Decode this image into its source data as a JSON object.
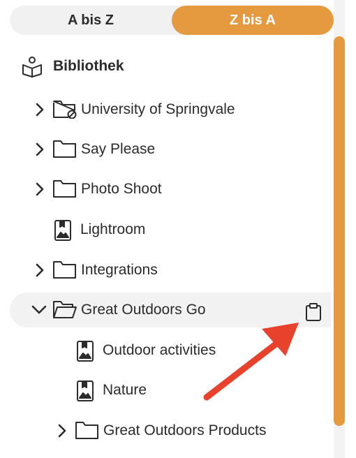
{
  "sort": {
    "az_label": "A bis Z",
    "za_label": "Z bis A",
    "active": "Z bis A"
  },
  "tree": {
    "root_label": "Bibliothek",
    "items": [
      {
        "label": "University of Springvale",
        "type": "folder-restricted",
        "expandable": true,
        "expanded": false,
        "depth": 1
      },
      {
        "label": "Say Please",
        "type": "folder",
        "expandable": true,
        "expanded": false,
        "depth": 1
      },
      {
        "label": "Photo Shoot",
        "type": "folder",
        "expandable": true,
        "expanded": false,
        "depth": 1
      },
      {
        "label": "Lightroom",
        "type": "collection",
        "expandable": false,
        "depth": 1
      },
      {
        "label": "Integrations",
        "type": "folder",
        "expandable": true,
        "expanded": false,
        "depth": 1
      },
      {
        "label": "Great Outdoors Go",
        "type": "folder-open",
        "expandable": true,
        "expanded": true,
        "depth": 1,
        "selected": true
      },
      {
        "label": "Outdoor activities",
        "type": "collection",
        "expandable": false,
        "depth": 2
      },
      {
        "label": "Nature",
        "type": "collection",
        "expandable": false,
        "depth": 2
      },
      {
        "label": "Great Outdoors Products",
        "type": "folder",
        "expandable": true,
        "expanded": false,
        "depth": 2
      }
    ]
  },
  "colors": {
    "accent": "#e69a3f",
    "arrow": "#e8412c",
    "text": "#2b2b2b",
    "toggle_bg": "#f1f1f1",
    "selected_bg": "#f2f2f2"
  },
  "icons": {
    "root": "library-book-icon",
    "paste": "clipboard-icon"
  }
}
